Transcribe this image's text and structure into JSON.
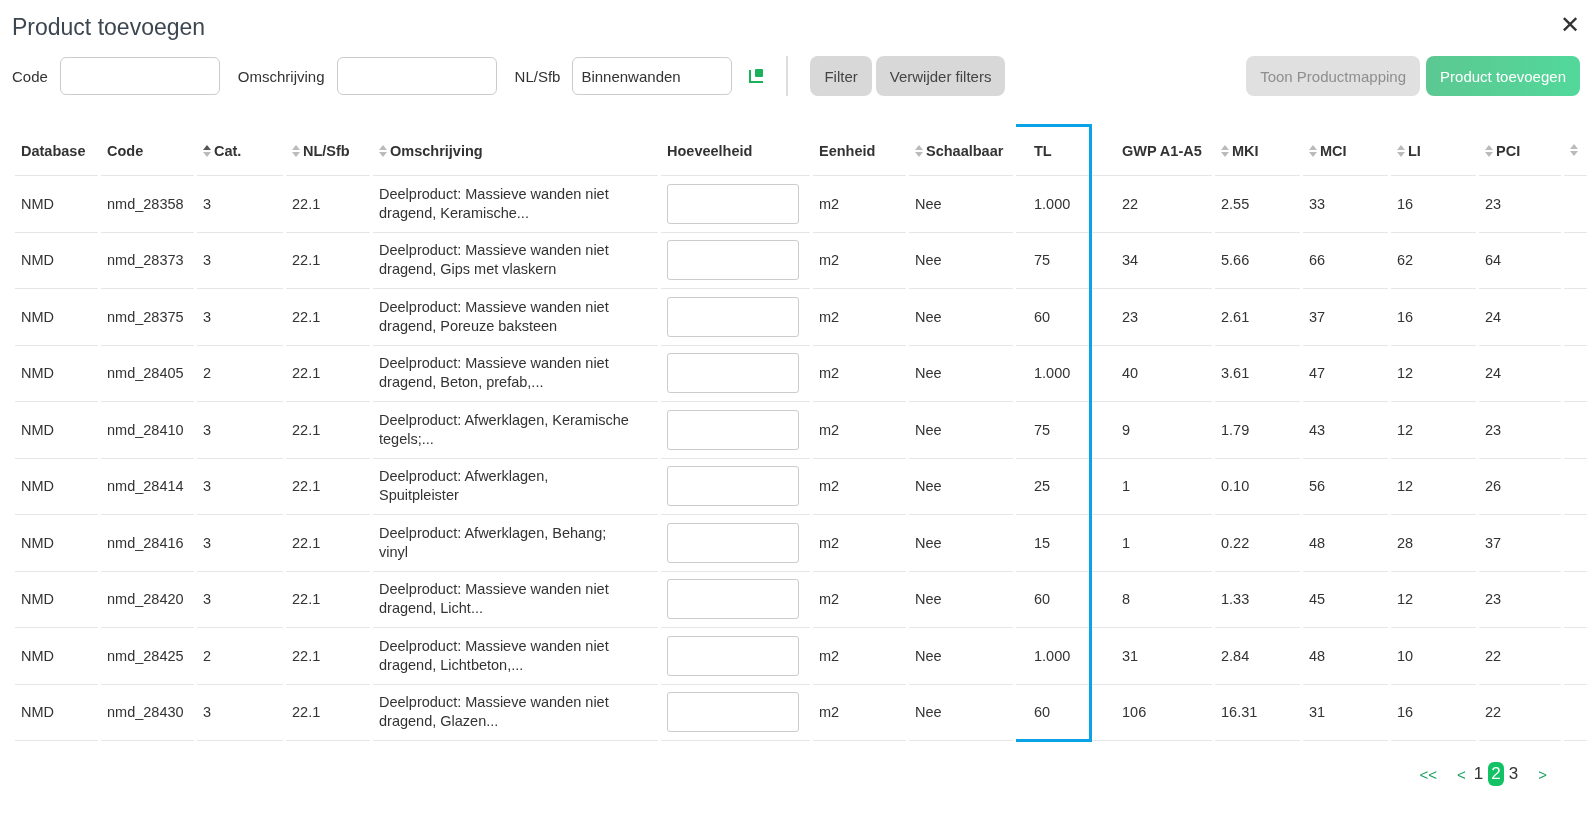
{
  "dialog": {
    "title": "Product toevoegen",
    "close": "✕"
  },
  "filters": [
    {
      "label": "Code"
    },
    {
      "label": "Omschrijving"
    },
    {
      "label": "NL/Sfb",
      "value": "Binnenwanden"
    }
  ],
  "filter_buttons": [
    {
      "label": "Filter"
    },
    {
      "label": "Verwijder filters"
    }
  ],
  "action_buttons": [
    {
      "label": "Toon Productmapping",
      "kind": "secondary",
      "disabled": true
    },
    {
      "label": "Product toevoegen",
      "kind": "primary",
      "disabled": true
    }
  ],
  "table": {
    "columns": [
      {
        "label": "Database",
        "highlighted": false
      },
      {
        "label": "Code",
        "highlighted": false
      },
      {
        "label": "Cat.",
        "sorted": true,
        "highlighted": false
      },
      {
        "label": "NL/Sfb",
        "sorted": false,
        "highlighted": false
      },
      {
        "label": "Omschrijving",
        "sorted": false,
        "highlighted": false
      },
      {
        "label": "Hoeveelheid",
        "highlighted": false
      },
      {
        "label": "Eenheid",
        "highlighted": false
      },
      {
        "label": "Schaalbaar",
        "sorted": false,
        "highlighted": false
      },
      {
        "label": "TL",
        "highlighted": true
      },
      {
        "label": "GWP A1-A5",
        "highlighted": false
      },
      {
        "label": "MKI",
        "sorted": false,
        "highlighted": false
      },
      {
        "label": "MCI",
        "sorted": false,
        "highlighted": false
      },
      {
        "label": "LI",
        "sorted": false,
        "highlighted": false
      },
      {
        "label": "PCI",
        "sorted": false,
        "highlighted": false
      },
      {
        "sorted": false,
        "highlighted": false
      }
    ],
    "rows": [
      [
        "NMD",
        "nmd_28358",
        "3",
        "22.1",
        "Deelproduct: Massieve wanden niet dragend, Keramische...",
        "",
        "m2",
        "Nee",
        "1.000",
        "22",
        "2.55",
        "33",
        "16",
        "23"
      ],
      [
        "NMD",
        "nmd_28373",
        "3",
        "22.1",
        "Deelproduct: Massieve wanden niet dragend, Gips met vlaskern",
        "",
        "m2",
        "Nee",
        "75",
        "34",
        "5.66",
        "66",
        "62",
        "64"
      ],
      [
        "NMD",
        "nmd_28375",
        "3",
        "22.1",
        "Deelproduct: Massieve wanden niet dragend, Poreuze baksteen",
        "",
        "m2",
        "Nee",
        "60",
        "23",
        "2.61",
        "37",
        "16",
        "24"
      ],
      [
        "NMD",
        "nmd_28405",
        "2",
        "22.1",
        "Deelproduct: Massieve wanden niet dragend, Beton, prefab,...",
        "",
        "m2",
        "Nee",
        "1.000",
        "40",
        "3.61",
        "47",
        "12",
        "24"
      ],
      [
        "NMD",
        "nmd_28410",
        "3",
        "22.1",
        "Deelproduct: Afwerklagen, Keramische tegels;...",
        "",
        "m2",
        "Nee",
        "75",
        "9",
        "1.79",
        "43",
        "12",
        "23"
      ],
      [
        "NMD",
        "nmd_28414",
        "3",
        "22.1",
        "Deelproduct: Afwerklagen, Spuitpleister",
        "",
        "m2",
        "Nee",
        "25",
        "1",
        "0.10",
        "56",
        "12",
        "26"
      ],
      [
        "NMD",
        "nmd_28416",
        "3",
        "22.1",
        "Deelproduct: Afwerklagen, Behang; vinyl",
        "",
        "m2",
        "Nee",
        "15",
        "1",
        "0.22",
        "48",
        "28",
        "37"
      ],
      [
        "NMD",
        "nmd_28420",
        "3",
        "22.1",
        "Deelproduct: Massieve wanden niet dragend, Licht...",
        "",
        "m2",
        "Nee",
        "60",
        "8",
        "1.33",
        "45",
        "12",
        "23"
      ],
      [
        "NMD",
        "nmd_28425",
        "2",
        "22.1",
        "Deelproduct: Massieve wanden niet dragend, Lichtbeton,...",
        "",
        "m2",
        "Nee",
        "1.000",
        "31",
        "2.84",
        "48",
        "10",
        "22"
      ],
      [
        "NMD",
        "nmd_28430",
        "3",
        "22.1",
        "Deelproduct: Massieve wanden niet dragend, Glazen...",
        "",
        "m2",
        "Nee",
        "60",
        "106",
        "16.31",
        "31",
        "16",
        "22"
      ]
    ]
  },
  "pagination": [
    {
      "label": "<<",
      "kind": "nav",
      "selected": false
    },
    {
      "label": "<",
      "kind": "nav",
      "selected": false
    },
    {
      "label": "1",
      "kind": "page",
      "selected": false
    },
    {
      "label": "2",
      "kind": "page",
      "selected": true
    },
    {
      "label": "3",
      "kind": "page",
      "selected": false
    },
    {
      "label": ">",
      "kind": "nav",
      "selected": false
    }
  ]
}
